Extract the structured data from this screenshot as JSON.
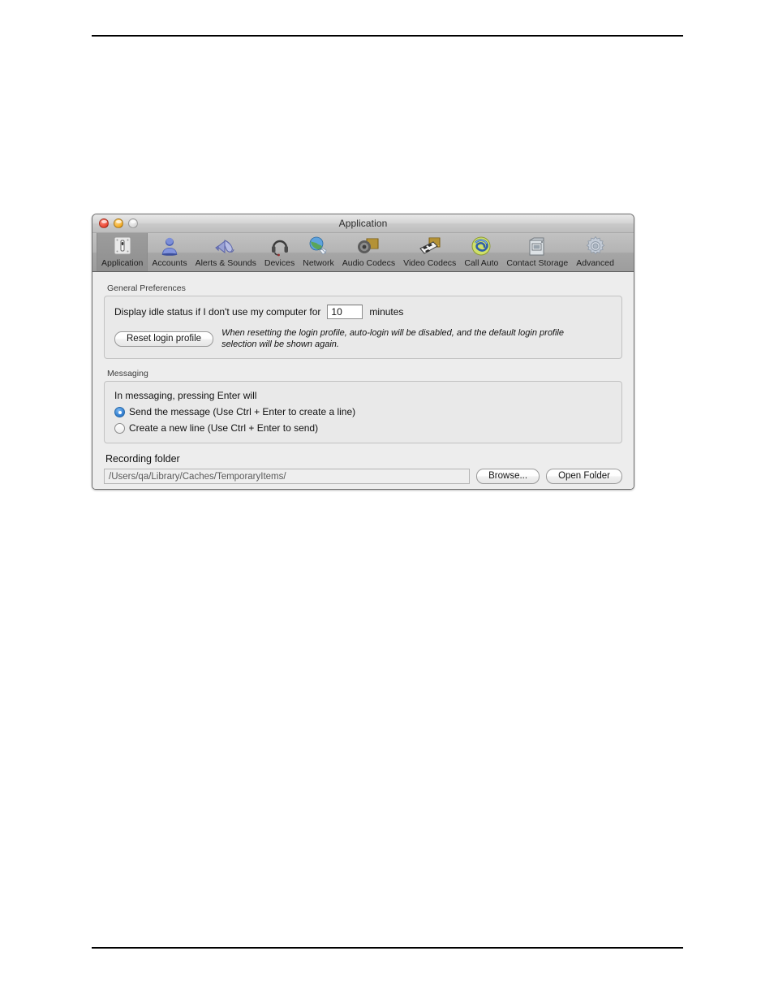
{
  "window": {
    "title": "Application",
    "controls": [
      {
        "name": "close",
        "icon": "close-traffic-light"
      },
      {
        "name": "minimize",
        "icon": "minimize-traffic-light"
      },
      {
        "name": "zoom",
        "icon": "zoom-traffic-light"
      }
    ]
  },
  "toolbar": {
    "selected": "Application",
    "items": [
      {
        "label": "Application",
        "icon": "application-icon"
      },
      {
        "label": "Accounts",
        "icon": "accounts-person-icon"
      },
      {
        "label": "Alerts & Sounds",
        "icon": "alerts-megaphone-icon"
      },
      {
        "label": "Devices",
        "icon": "devices-headset-icon"
      },
      {
        "label": "Network",
        "icon": "network-globe-icon"
      },
      {
        "label": "Audio Codecs",
        "icon": "audio-codecs-speaker-icon"
      },
      {
        "label": "Video Codecs",
        "icon": "video-codecs-film-icon"
      },
      {
        "label": "Call Auto",
        "icon": "call-auto-swirl-icon"
      },
      {
        "label": "Contact Storage",
        "icon": "contact-storage-server-icon"
      },
      {
        "label": "Advanced",
        "icon": "advanced-gear-icon"
      }
    ]
  },
  "general": {
    "caption": "General Preferences",
    "idle_label_before": "Display idle status if I don't use my computer for",
    "idle_value": "10",
    "idle_placeholder": "10",
    "idle_label_after": "minutes",
    "reset_button": "Reset login profile",
    "reset_hint": "When resetting the login profile, auto-login will be disabled, and the default login profile selection will be shown again."
  },
  "messaging": {
    "caption": "Messaging",
    "heading": "In messaging, pressing Enter will",
    "options": [
      {
        "label": "Send the message (Use Ctrl + Enter to create a line)",
        "selected": true
      },
      {
        "label": "Create a new line (Use Ctrl + Enter to send)",
        "selected": false
      }
    ]
  },
  "recording": {
    "label": "Recording folder",
    "path_value": "/Users/qa/Library/Caches/TemporaryItems/",
    "path_placeholder": "/Users/qa/Library/Caches/TemporaryItems/",
    "browse_button": "Browse...",
    "open_folder_button": "Open Folder"
  },
  "colors": {
    "accent": "#3b86d6",
    "window_chrome": "#b4b4b4",
    "content_bg": "#ededed"
  }
}
